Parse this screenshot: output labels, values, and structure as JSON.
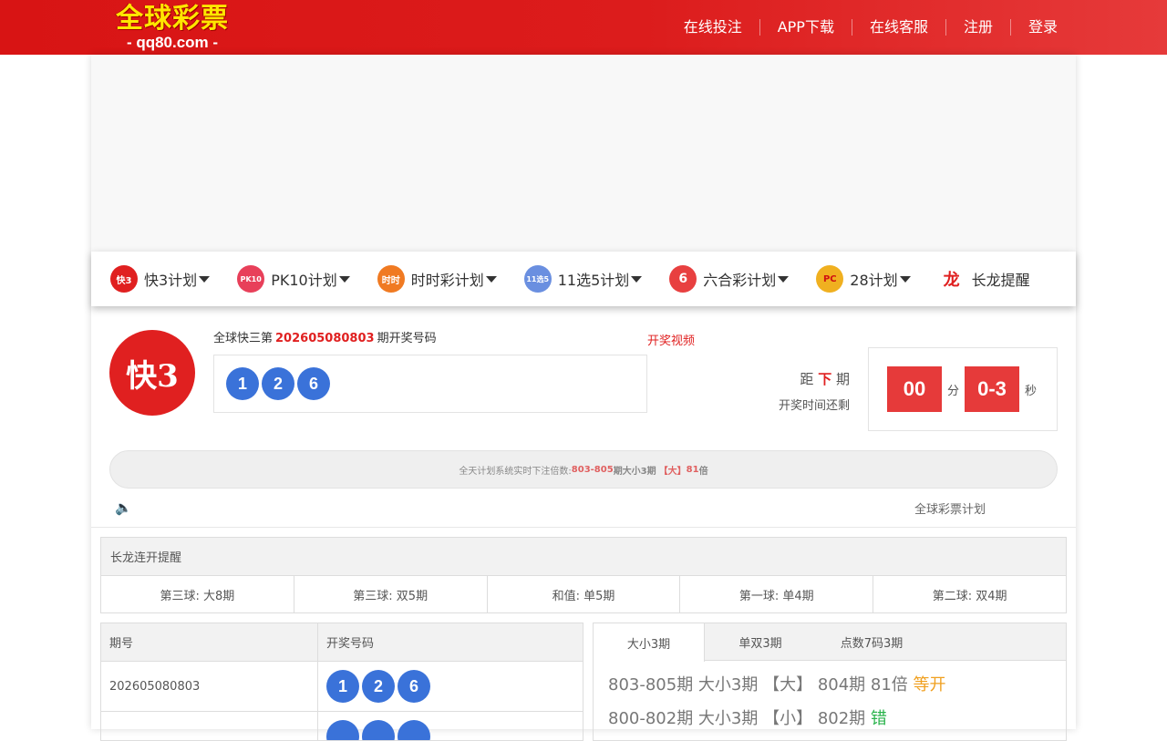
{
  "header": {
    "logo_title": "全球彩票",
    "logo_sub": "- qq80.com -",
    "nav": [
      "在线投注",
      "APP下载",
      "在线客服",
      "注册",
      "登录"
    ]
  },
  "menu": [
    {
      "label": "快3计划",
      "icon": "快3",
      "color": "#e02020",
      "dropdown": true
    },
    {
      "label": "PK10计划",
      "icon": "PK10",
      "color": "#e8405a",
      "dropdown": true
    },
    {
      "label": "时时彩计划",
      "icon": "时时",
      "color": "#f07a22",
      "dropdown": true
    },
    {
      "label": "11选5计划",
      "icon": "11选5",
      "color": "#6a8fe0",
      "dropdown": true
    },
    {
      "label": "六合彩计划",
      "icon": "6",
      "color": "#e84040",
      "dropdown": true
    },
    {
      "label": "28计划",
      "icon": "PC",
      "color": "#f0b020",
      "dropdown": true
    },
    {
      "label": "长龙提醒",
      "icon": "龙",
      "color": "#e02020",
      "dropdown": false
    }
  ],
  "draw": {
    "logo_text": "快3",
    "title_prefix": "全球快三第",
    "issue": "202605080803",
    "title_suffix": "期开奖号码",
    "video_link": "开奖视频",
    "balls": [
      "1",
      "2",
      "6"
    ],
    "next_prefix": "距",
    "next_highlight": "下",
    "next_suffix": "期",
    "remain_label": "开奖时间还剩",
    "minutes": "00",
    "minutes_unit": "分",
    "seconds": "0-3",
    "seconds_unit": "秒"
  },
  "ticker": {
    "prefix": "全天计划系统实时下注倍数:",
    "highlight1": "803-805",
    "middle": "期大小3期",
    "highlight2": "【大】",
    "highlight3": "81",
    "suffix": "倍"
  },
  "plan_label": "全球彩票计划",
  "dragon": {
    "title": "长龙连开提醒",
    "items": [
      "第三球: 大8期",
      "第三球: 双5期",
      "和值: 单5期",
      "第一球: 单4期",
      "第二球: 双4期"
    ]
  },
  "results": {
    "headers": [
      "期号",
      "开奖号码"
    ],
    "rows": [
      {
        "issue": "202605080803",
        "balls": [
          "1",
          "2",
          "6"
        ]
      },
      {
        "issue": "",
        "balls": [
          "",
          "",
          ""
        ]
      }
    ]
  },
  "plan": {
    "tabs": [
      "大小3期",
      "单双3期",
      "点数7码3期"
    ],
    "lines": [
      {
        "text": "803-805期 大小3期 【大】 804期 81倍",
        "status": "等开",
        "status_type": "ok"
      },
      {
        "text": "800-802期 大小3期 【小】 802期",
        "status": "错",
        "status_type": "bad"
      }
    ]
  },
  "colors": {
    "brand_red": "#d81414",
    "ball_blue": "#3a72d9",
    "timer_red": "#e63a3a",
    "logo_yellow": "#ffe600"
  }
}
